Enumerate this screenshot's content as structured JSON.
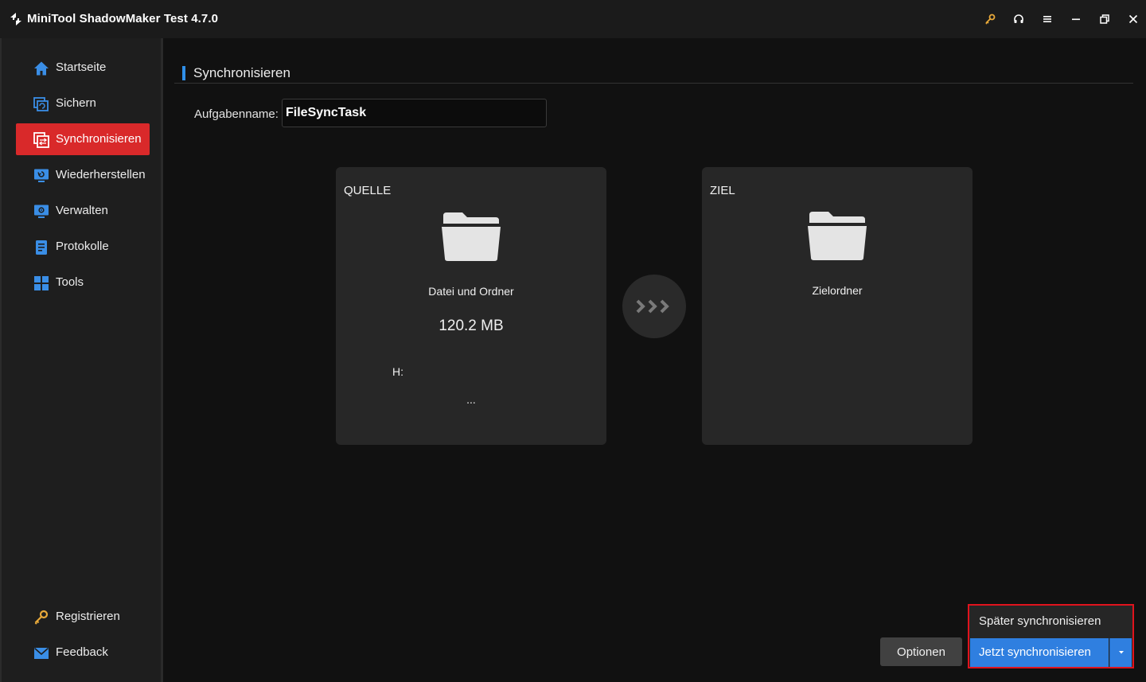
{
  "app": {
    "title": "MiniTool ShadowMaker Test 4.7.0"
  },
  "titlebar": {
    "icons": [
      "key-icon",
      "headset-icon",
      "menu-icon",
      "minimize-icon",
      "restore-icon",
      "close-icon"
    ]
  },
  "sidebar": {
    "items": [
      {
        "label": "Startseite",
        "icon": "home-icon"
      },
      {
        "label": "Sichern",
        "icon": "backup-icon"
      },
      {
        "label": "Synchronisieren",
        "icon": "sync-icon",
        "active": true
      },
      {
        "label": "Wiederherstellen",
        "icon": "restore-monitor-icon"
      },
      {
        "label": "Verwalten",
        "icon": "manage-monitor-icon"
      },
      {
        "label": "Protokolle",
        "icon": "log-icon"
      },
      {
        "label": "Tools",
        "icon": "tools-grid-icon"
      }
    ],
    "bottom": [
      {
        "label": "Registrieren",
        "icon": "key-icon"
      },
      {
        "label": "Feedback",
        "icon": "mail-icon"
      }
    ]
  },
  "main": {
    "page_title": "Synchronisieren",
    "task_name_label": "Aufgabenname:",
    "task_name_value": "FileSyncTask",
    "source": {
      "heading": "QUELLE",
      "type": "Datei und Ordner",
      "size": "120.2 MB",
      "drive": "H:",
      "more": "..."
    },
    "destination": {
      "heading": "ZIEL",
      "type": "Zielordner"
    }
  },
  "actions": {
    "options_label": "Optionen",
    "sync_later_label": "Später synchronisieren",
    "sync_now_label": "Jetzt synchronisieren"
  },
  "colors": {
    "accent_red": "#d9292a",
    "accent_blue": "#2f7fe0",
    "highlight_border": "#e0131d",
    "icon_blue": "#3a8ee6",
    "key_gold": "#e8a93a"
  }
}
